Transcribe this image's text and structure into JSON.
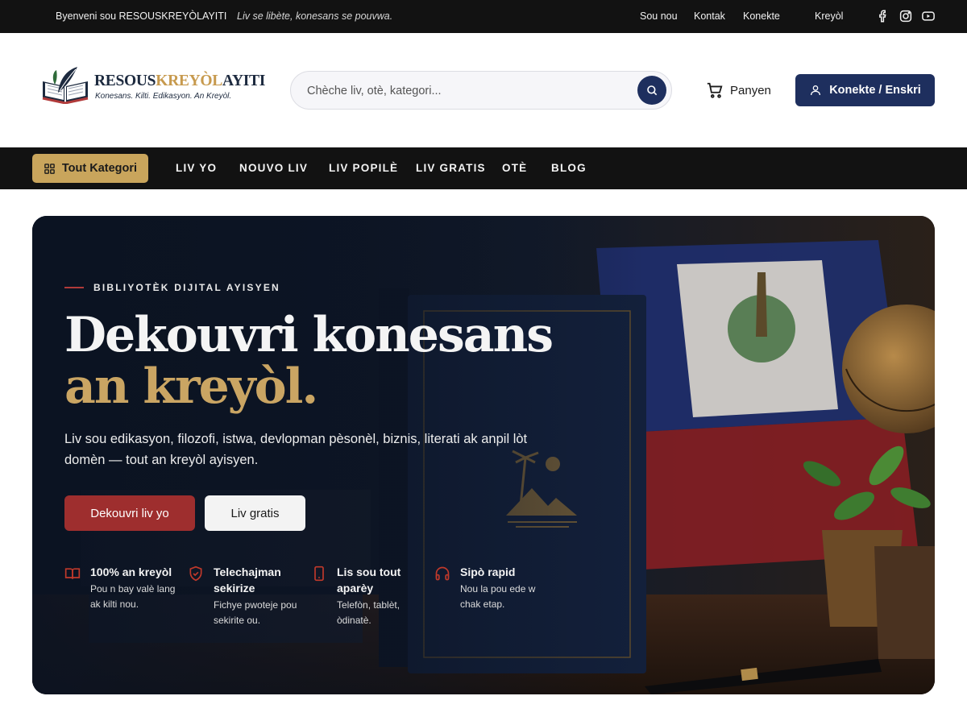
{
  "topbar": {
    "welcome": "Byenveni sou RESOUSKREYÒLAYITI",
    "tagline": "Liv se libète, konesans se pouvwa.",
    "links": [
      "Sou nou",
      "Kontak",
      "Konekte"
    ],
    "language": "Kreyòl",
    "social_icons": [
      "facebook-icon",
      "instagram-icon",
      "youtube-icon"
    ]
  },
  "header": {
    "logo": {
      "part1": "RESOUS",
      "part2": "KREYÒL",
      "part3": "AYITI",
      "motto": "Konesans. Kilti. Edikasyon. An Kreyòl."
    },
    "search": {
      "placeholder": "Chèche liv, otè, kategori..."
    },
    "cart_label": "Panyen",
    "login_label": "Konekte / Enskri"
  },
  "nav": {
    "categories_label": "Tout Kategori",
    "links": [
      "LIV YO",
      "NOUVO LIV",
      "LIV POPILÈ",
      "LIV GRATIS",
      "OTÈ",
      "BLOG"
    ]
  },
  "hero": {
    "eyebrow": "BIBLIYOTÈK DIJITAL AYISYEN",
    "title_line1": "Dekouvri konesans",
    "title_line2": "an kreyòl.",
    "lead": "Liv sou edikasyon, filozofi, istwa, devlopman pèsonèl, biznis, literati ak anpil lòt domèn — tout an kreyòl ayisyen.",
    "primary_button": "Dekouvri liv yo",
    "secondary_button": "Liv gratis",
    "features": [
      {
        "icon": "open-book-icon",
        "title": "100% an kreyòl",
        "desc": "Pou n bay valè lang ak kilti nou."
      },
      {
        "icon": "shield-check-icon",
        "title": "Telechajman sekirize",
        "desc": "Fichye pwoteje pou sekirite ou."
      },
      {
        "icon": "phone-icon",
        "title": "Lis sou tout aparèy",
        "desc": "Telefòn, tablèt, òdinatè."
      },
      {
        "icon": "headphones-icon",
        "title": "Sipò rapid",
        "desc": "Nou la pou ede w chak etap."
      }
    ]
  },
  "colors": {
    "dark_bar": "#121212",
    "navy": "#1e2f5e",
    "gold": "#c9a55c",
    "red": "#9e2e2e"
  }
}
